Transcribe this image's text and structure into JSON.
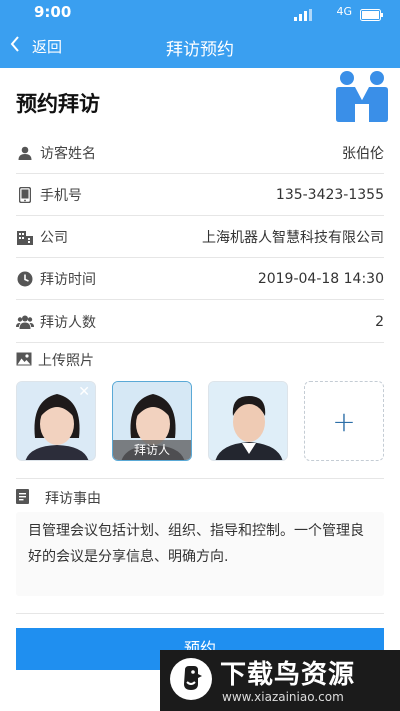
{
  "status_bar": {
    "time": "9:00",
    "network": "4G"
  },
  "nav": {
    "back_label": "返回",
    "title": "拜访预约"
  },
  "page": {
    "heading": "预约拜访"
  },
  "fields": {
    "visitor_name": {
      "label": "访客姓名",
      "value": "张伯伦",
      "icon": "person-icon"
    },
    "phone": {
      "label": "手机号",
      "value": "135-3423-1355",
      "icon": "phone-icon"
    },
    "company": {
      "label": "公司",
      "value": "上海机器人智慧科技有限公司",
      "icon": "building-icon"
    },
    "visit_time": {
      "label": "拜访时间",
      "value": "2019-04-18 14:30",
      "icon": "clock-icon"
    },
    "visitor_count": {
      "label": "拜访人数",
      "value": "2",
      "icon": "group-icon"
    }
  },
  "upload": {
    "label": "上传照片",
    "icon": "image-icon",
    "photo_caption": "拜访人",
    "add_symbol": "+"
  },
  "reason": {
    "label": "拜访事由",
    "icon": "document-icon",
    "text": "目管理会议包括计划、组织、指导和控制。一个管理良好的会议是分享信息、明确方向."
  },
  "submit": {
    "label": "预约"
  },
  "watermark": {
    "title": "下载鸟资源",
    "url": "www.xiazainiao.com"
  },
  "colors": {
    "primary": "#3a9ff0",
    "button": "#1f8ff0"
  }
}
